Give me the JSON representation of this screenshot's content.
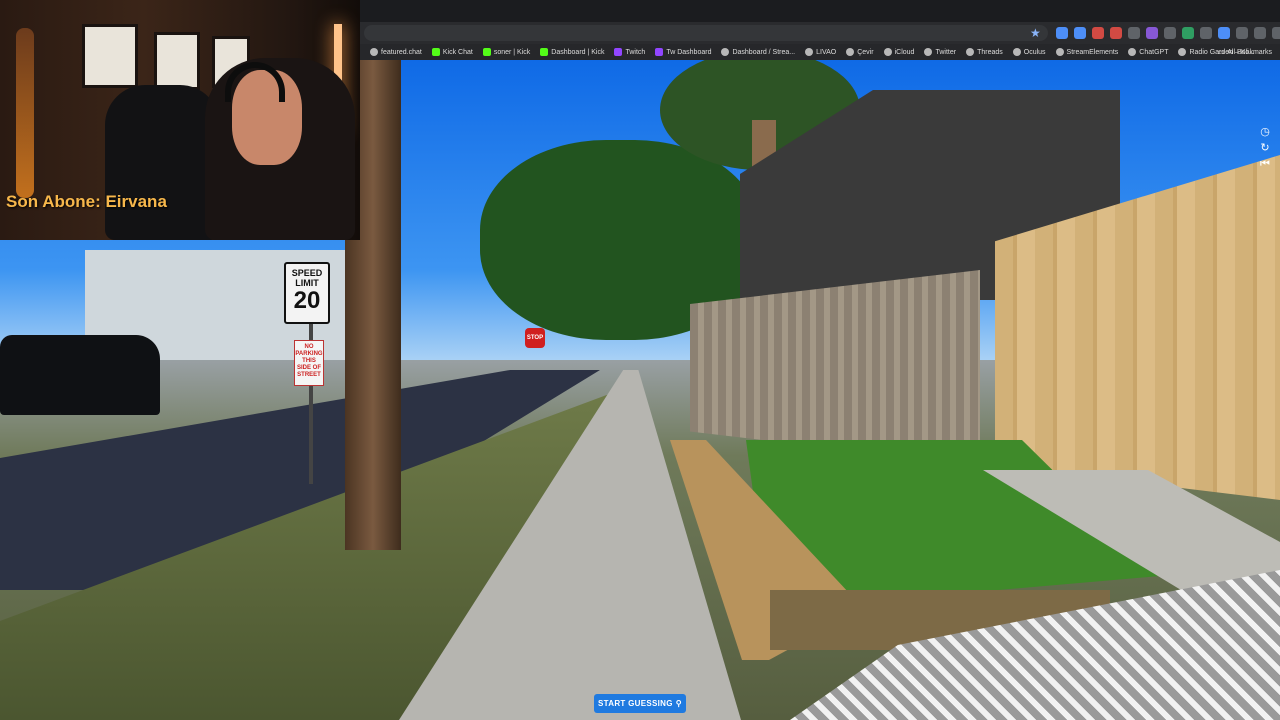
{
  "browser": {
    "bookmarks": [
      {
        "label": "featured.chat",
        "icon": "globe-icon"
      },
      {
        "label": "Kick Chat",
        "icon": "kick-icon"
      },
      {
        "label": "soner | Kick",
        "icon": "kick-icon"
      },
      {
        "label": "Dashboard | Kick",
        "icon": "kick-icon"
      },
      {
        "label": "Twitch",
        "icon": "twitch-icon"
      },
      {
        "label": "Tw Dashboard",
        "icon": "twitch-icon"
      },
      {
        "label": "Dashboard / Strea...",
        "icon": "streamelements-icon"
      },
      {
        "label": "LIVAO",
        "icon": "globe-icon"
      },
      {
        "label": "Çevir",
        "icon": "translate-icon"
      },
      {
        "label": "iCloud",
        "icon": "apple-icon"
      },
      {
        "label": "Twitter",
        "icon": "globe-icon"
      },
      {
        "label": "Threads",
        "icon": "threads-icon"
      },
      {
        "label": "Oculus",
        "icon": "globe-icon"
      },
      {
        "label": "StreamElements",
        "icon": "globe-icon"
      },
      {
        "label": "ChatGPT",
        "icon": "chatgpt-icon"
      },
      {
        "label": "Radio Garden – Kli...",
        "icon": "globe-icon"
      }
    ],
    "all_bookmarks": "All Bookmarks",
    "star_icon": "star-icon"
  },
  "webcam": {
    "caption": "Son Abone: Eirvana"
  },
  "street_view": {
    "speed_sign_top": "SPEED LIMIT",
    "speed_sign_value": "20",
    "no_parking_sign": "NO PARKING THIS SIDE OF STREET",
    "stop_sign": "STOP",
    "controls": [
      {
        "icon": "clock-icon",
        "glyph": "◷"
      },
      {
        "icon": "refresh-icon",
        "glyph": "↻"
      },
      {
        "icon": "back-to-start-icon",
        "glyph": "⏮"
      }
    ]
  },
  "game": {
    "start_button_label": "START GUESSING",
    "start_button_icon": "map-pin-icon",
    "accent_color": "#1f7ae0"
  }
}
